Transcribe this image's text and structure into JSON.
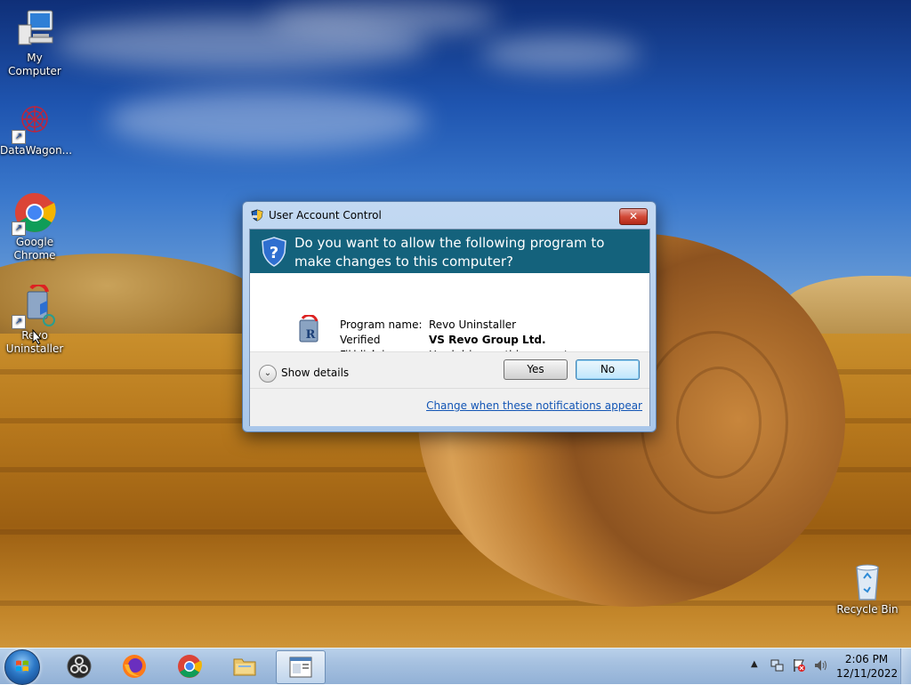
{
  "desktop": {
    "icons": [
      {
        "label": "My Computer",
        "icon": "computer-icon"
      },
      {
        "label": "DataWagon...",
        "icon": "datawagon-icon"
      },
      {
        "label": "Google Chrome",
        "icon": "chrome-icon"
      },
      {
        "label": "Revo Uninstaller",
        "icon": "revo-uninstaller-icon"
      },
      {
        "label": "Recycle Bin",
        "icon": "recycle-bin-icon"
      }
    ]
  },
  "uac": {
    "title": "User Account Control",
    "close_label": "✕",
    "question": "Do you want to allow the following program to make changes to this computer?",
    "program_name_label": "Program name:",
    "program_name": "Revo Uninstaller",
    "publisher_label": "Verified publisher:",
    "publisher": "VS Revo Group Ltd.",
    "origin_label": "File origin:",
    "origin": "Hard drive on this computer",
    "show_details": "Show details",
    "yes": "Yes",
    "no": "No",
    "change_link": "Change when these notifications appear",
    "banner_color": "#14627c"
  },
  "taskbar": {
    "items": [
      {
        "name": "start",
        "icon": "windows-logo-icon"
      },
      {
        "name": "obs",
        "icon": "obs-icon"
      },
      {
        "name": "firefox",
        "icon": "firefox-icon"
      },
      {
        "name": "chrome",
        "icon": "chrome-icon"
      },
      {
        "name": "explorer",
        "icon": "folder-icon"
      },
      {
        "name": "active-window",
        "icon": "window-icon"
      }
    ],
    "time": "2:06 PM",
    "date": "12/11/2022"
  }
}
